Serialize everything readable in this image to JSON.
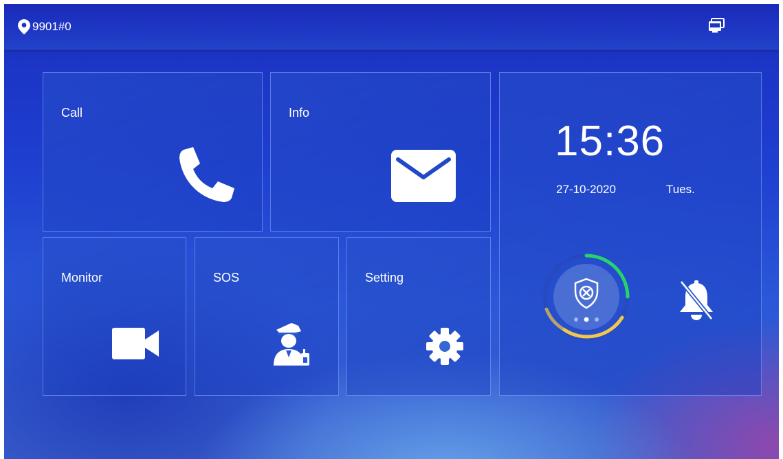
{
  "topbar": {
    "location": "9901#0",
    "location_icon": "location-pin-icon",
    "status_icon": "network-status-icon"
  },
  "tiles": {
    "call": {
      "label": "Call",
      "icon": "phone-icon"
    },
    "info": {
      "label": "Info",
      "icon": "envelope-icon"
    },
    "monitor": {
      "label": "Monitor",
      "icon": "video-camera-icon"
    },
    "sos": {
      "label": "SOS",
      "icon": "security-guard-icon"
    },
    "setting": {
      "label": "Setting",
      "icon": "gear-icon"
    }
  },
  "clock": {
    "time": "15:36",
    "date": "27-10-2020",
    "day": "Tues."
  },
  "status_panel": {
    "arm_icon": "shield-disarmed-icon",
    "mute_icon": "bell-muted-icon",
    "page_dots": 3,
    "active_dot": 2
  },
  "colors": {
    "ring_green": "#27d36b",
    "ring_yellow": "#f2c84b",
    "text": "#ffffff"
  }
}
